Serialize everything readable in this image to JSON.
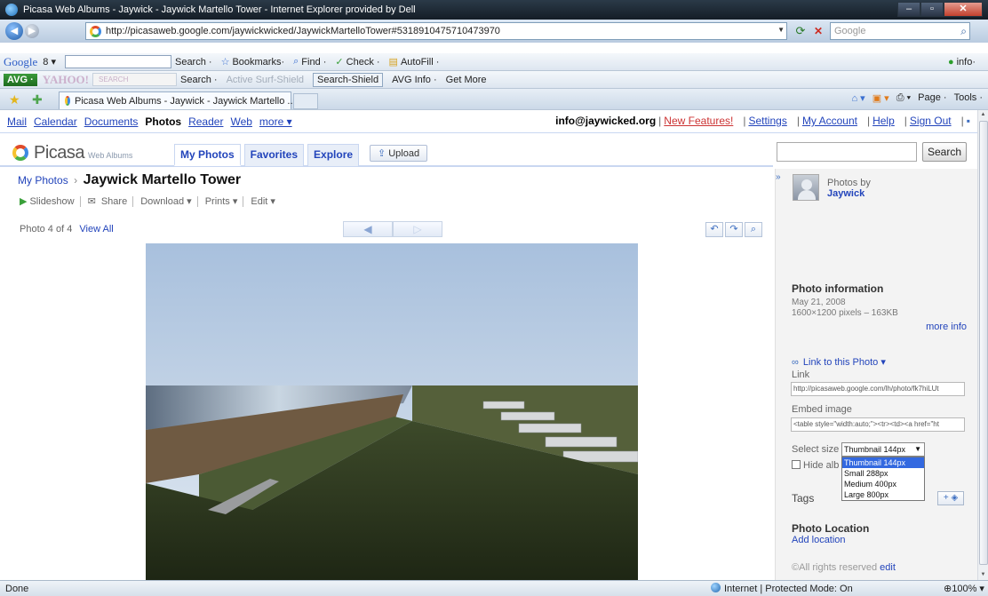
{
  "browser": {
    "window_title": "Picasa Web Albums - Jaywick - Jaywick Martello Tower - Internet Explorer provided by Dell",
    "url": "http://picasaweb.google.com/jaywickwicked/JaywickMartelloTower#5318910475710473970",
    "search_placeholder": "Google",
    "tab_title": "Picasa Web Albums - Jaywick - Jaywick Martello ...",
    "google_toolbar": {
      "logo": "Google",
      "logo_suffix": "8 ▾",
      "search": "Search ·",
      "bookmarks": "Bookmarks·",
      "find": "Find ·",
      "check": "Check ·",
      "autofill": "AutoFill ·",
      "info": "info·"
    },
    "avg_toolbar": {
      "avg": "AVG ·",
      "yahoo": "YAHOO!",
      "yahoo_search": "SEARCH",
      "search": "Search ·",
      "active_surf": "Active Surf-Shield",
      "search_shield": "Search-Shield",
      "avg_info": "AVG Info ·",
      "get_more": "Get More"
    },
    "command_bar": {
      "page": "Page ·",
      "tools": "Tools ·"
    },
    "status": {
      "left": "Done",
      "zone": "Internet | Protected Mode: On",
      "zoom": "100%"
    }
  },
  "gbar": {
    "links": [
      "Mail",
      "Calendar",
      "Documents",
      "Photos",
      "Reader",
      "Web",
      "more ▾"
    ],
    "current": "Photos",
    "email": "info@jaywicked.org",
    "new_features": "New Features!",
    "settings": "Settings",
    "my_account": "My Account",
    "help": "Help",
    "sign_out": "Sign Out"
  },
  "picasa": {
    "logo": "Picasa",
    "logo_sub": "Web Albums",
    "tabs": [
      "My Photos",
      "Favorites",
      "Explore"
    ],
    "upload": "Upload",
    "search_button": "Search"
  },
  "main": {
    "breadcrumb_link": "My Photos",
    "breadcrumb_sep": "›",
    "album_title": "Jaywick Martello Tower",
    "actions": {
      "slideshow": "Slideshow",
      "share": "Share",
      "download": "Download ▾",
      "prints": "Prints ▾",
      "edit": "Edit ▾"
    },
    "photo_count": "Photo 4 of 4",
    "view_all": "View All"
  },
  "sidebar": {
    "photos_by": "Photos by",
    "owner": "Jaywick",
    "photo_info_title": "Photo information",
    "date": "May 21, 2008",
    "dimensions": "1600×1200 pixels – 163KB",
    "more_info": "more info",
    "link_to_photo": "Link to this Photo ▾",
    "link_label": "Link",
    "link_value": "http://picasaweb.google.com/lh/photo/fk7hiLUt",
    "embed_label": "Embed image",
    "embed_value": "<table style=\"width:auto;\"><tr><td><a href=\"ht",
    "select_size_label": "Select size",
    "selected_size": "Thumbnail 144px",
    "size_options": [
      "Thumbnail 144px",
      "Small 288px",
      "Medium 400px",
      "Large 800px"
    ],
    "hide_album": "Hide alb",
    "tags_title": "Tags",
    "tags_button": "+",
    "location_title": "Photo Location",
    "add_location": "Add location",
    "rights": "All rights reserved",
    "rights_edit": "edit"
  }
}
